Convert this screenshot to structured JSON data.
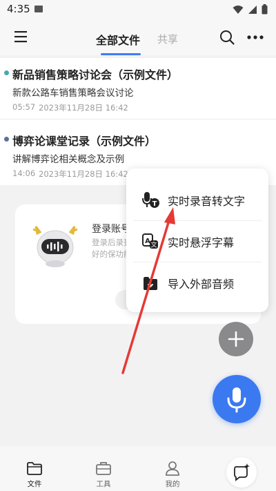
{
  "status_bar": {
    "time": "4:35"
  },
  "header": {
    "tabs": [
      {
        "label": "全部文件",
        "active": true
      },
      {
        "label": "共享",
        "active": false
      }
    ]
  },
  "files": [
    {
      "title": "新品销售策略讨论会（示例文件）",
      "description": "新款公路车销售策略会议讨论",
      "duration": "05:57",
      "date": "2023年11月28日 16:42",
      "dot_color": "#4aa7b0"
    },
    {
      "title": "博弈论课堂记录（示例文件）",
      "description": "讲解博弈论相关概念及示例",
      "duration": "14:06",
      "date": "2023年11月28日 16:42",
      "dot_color": "#5a6f9a"
    }
  ],
  "login_card": {
    "title": "登录账号",
    "description": "登录后录更好的保功能"
  },
  "popup_menu": {
    "items": [
      {
        "label": "实时录音转文字",
        "icon": "mic-text-icon"
      },
      {
        "label": "实时悬浮字幕",
        "icon": "float-caption-icon"
      },
      {
        "label": "导入外部音频",
        "icon": "import-audio-icon"
      }
    ]
  },
  "bottom_nav": {
    "items": [
      {
        "label": "文件",
        "icon": "folder-icon",
        "active": true
      },
      {
        "label": "工具",
        "icon": "toolbox-icon",
        "active": false
      },
      {
        "label": "我的",
        "icon": "person-icon",
        "active": false
      }
    ]
  },
  "colors": {
    "accent": "#3b79f0",
    "annotation_arrow": "#e53935"
  }
}
